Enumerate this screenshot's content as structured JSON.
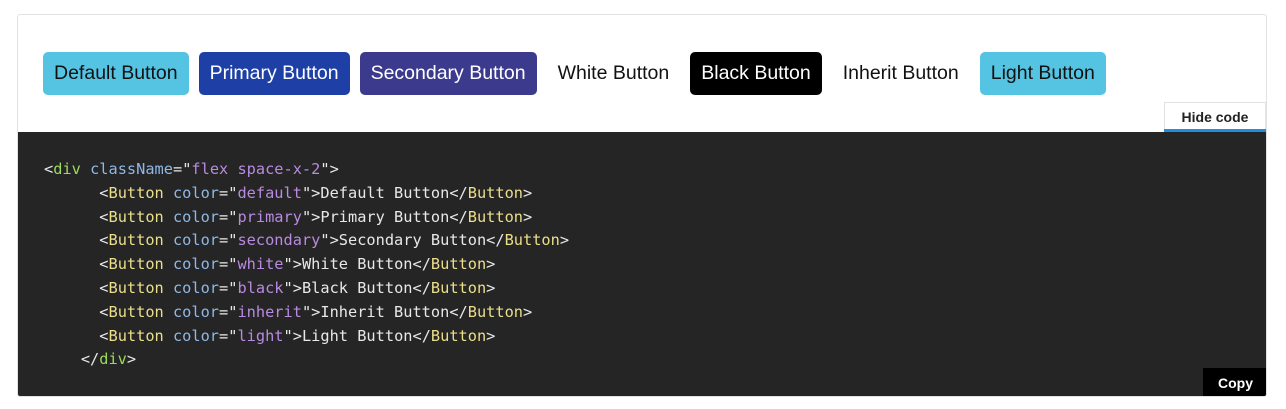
{
  "buttons": [
    {
      "label": "Default Button",
      "variant": "default",
      "bg": "#55c3e2",
      "fg": "#111111"
    },
    {
      "label": "Primary Button",
      "variant": "primary",
      "bg": "#1d3fa6",
      "fg": "#ffffff"
    },
    {
      "label": "Secondary Button",
      "variant": "secondary",
      "bg": "#3b3a8c",
      "fg": "#ffffff"
    },
    {
      "label": "White Button",
      "variant": "white",
      "bg": "#ffffff",
      "fg": "#111111"
    },
    {
      "label": "Black Button",
      "variant": "black",
      "bg": "#000000",
      "fg": "#ffffff"
    },
    {
      "label": "Inherit Button",
      "variant": "inherit",
      "bg": "transparent",
      "fg": "#111111"
    },
    {
      "label": "Light Button",
      "variant": "light",
      "bg": "#55c3e2",
      "fg": "#111111"
    }
  ],
  "hide_code_label": "Hide code",
  "copy_label": "Copy",
  "accent_color": "#1f8fe0",
  "code_bg": "#252525",
  "code": {
    "open": {
      "lt": "<",
      "tag": "div",
      "attr": "className",
      "eq": "=",
      "q1": "\"",
      "val": "flex space-x-2",
      "q2": "\"",
      "gt": ">"
    },
    "items": [
      {
        "indent": "      ",
        "lt": "<",
        "tag": "Button",
        "attr": "color",
        "eq": "=",
        "q1": "\"",
        "val": "default",
        "q2": "\"",
        "gt": ">",
        "text": "Default Button",
        "close_lt": "</",
        "close_tag": "Button",
        "close_gt": ">"
      },
      {
        "indent": "      ",
        "lt": "<",
        "tag": "Button",
        "attr": "color",
        "eq": "=",
        "q1": "\"",
        "val": "primary",
        "q2": "\"",
        "gt": ">",
        "text": "Primary Button",
        "close_lt": "</",
        "close_tag": "Button",
        "close_gt": ">"
      },
      {
        "indent": "      ",
        "lt": "<",
        "tag": "Button",
        "attr": "color",
        "eq": "=",
        "q1": "\"",
        "val": "secondary",
        "q2": "\"",
        "gt": ">",
        "text": "Secondary Button",
        "close_lt": "</",
        "close_tag": "Button",
        "close_gt": ">"
      },
      {
        "indent": "      ",
        "lt": "<",
        "tag": "Button",
        "attr": "color",
        "eq": "=",
        "q1": "\"",
        "val": "white",
        "q2": "\"",
        "gt": ">",
        "text": "White Button",
        "close_lt": "</",
        "close_tag": "Button",
        "close_gt": ">"
      },
      {
        "indent": "      ",
        "lt": "<",
        "tag": "Button",
        "attr": "color",
        "eq": "=",
        "q1": "\"",
        "val": "black",
        "q2": "\"",
        "gt": ">",
        "text": "Black Button",
        "close_lt": "</",
        "close_tag": "Button",
        "close_gt": ">"
      },
      {
        "indent": "      ",
        "lt": "<",
        "tag": "Button",
        "attr": "color",
        "eq": "=",
        "q1": "\"",
        "val": "inherit",
        "q2": "\"",
        "gt": ">",
        "text": "Inherit Button",
        "close_lt": "</",
        "close_tag": "Button",
        "close_gt": ">"
      },
      {
        "indent": "      ",
        "lt": "<",
        "tag": "Button",
        "attr": "color",
        "eq": "=",
        "q1": "\"",
        "val": "light",
        "q2": "\"",
        "gt": ">",
        "text": "Light Button",
        "close_lt": "</",
        "close_tag": "Button",
        "close_gt": ">"
      }
    ],
    "close": {
      "indent": "    ",
      "lt": "</",
      "tag": "div",
      "gt": ">"
    }
  }
}
